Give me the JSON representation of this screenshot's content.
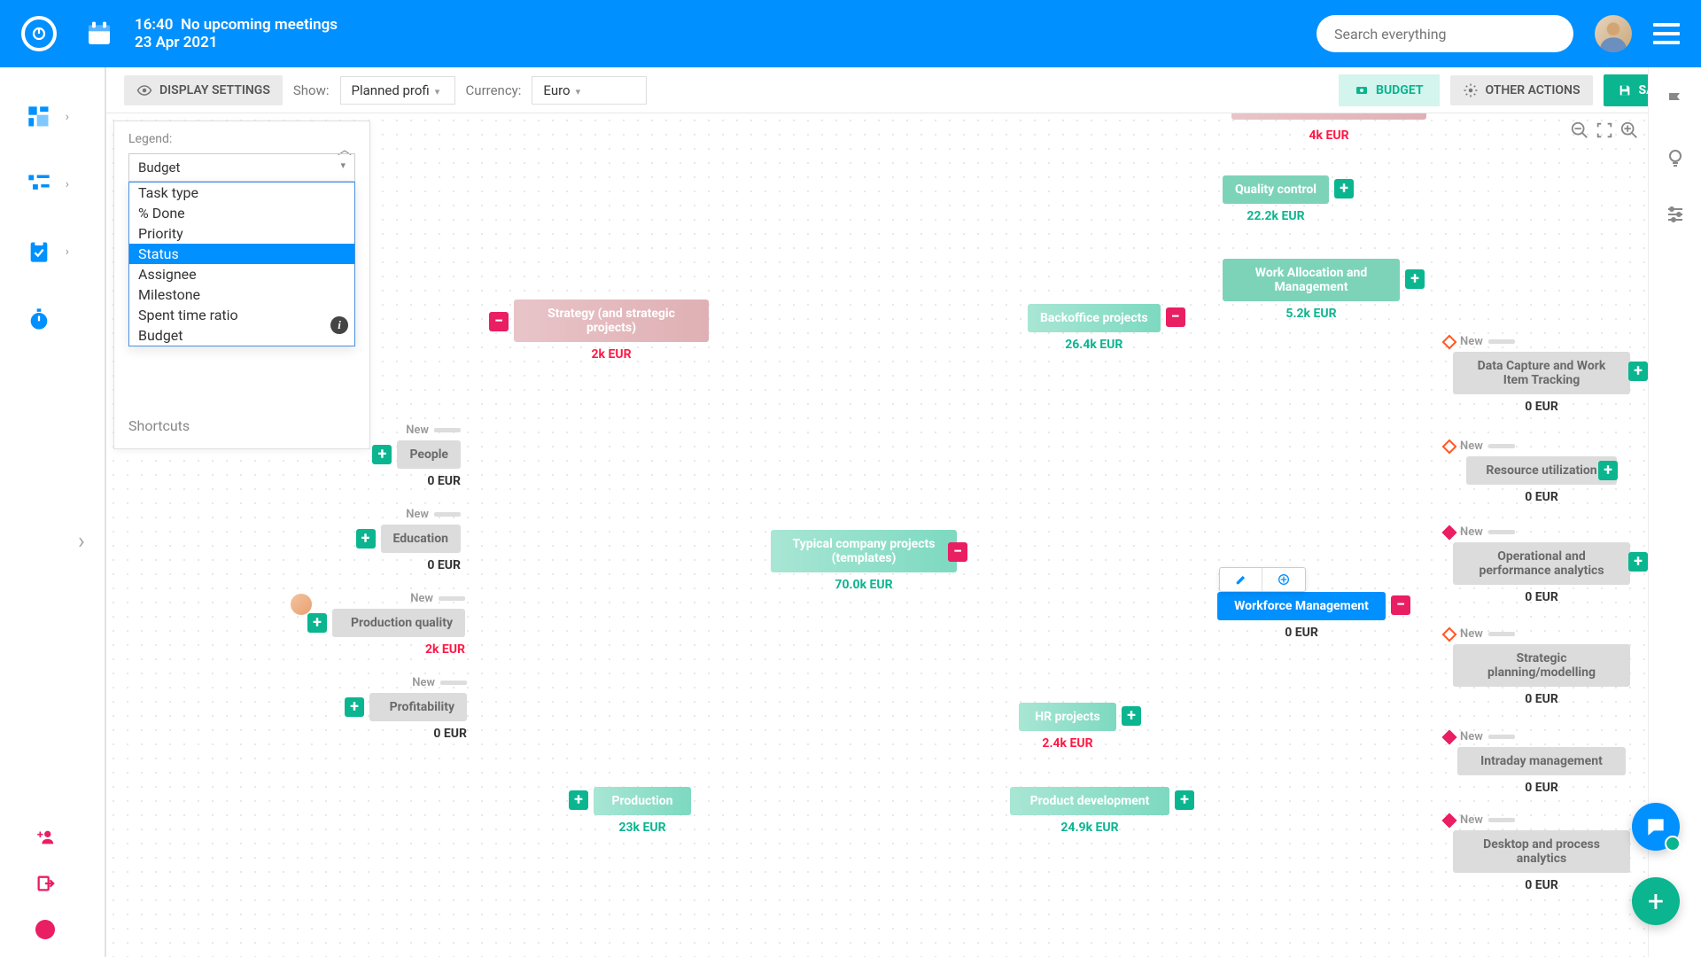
{
  "topbar": {
    "time": "16:40",
    "meetings": "No upcoming meetings",
    "date": "23 Apr 2021",
    "search_placeholder": "Search everything"
  },
  "toolbar": {
    "display_settings": "DISPLAY SETTINGS",
    "show_label": "Show:",
    "show_value": "Planned profi",
    "currency_label": "Currency:",
    "currency_value": "Euro",
    "budget": "BUDGET",
    "other_actions": "OTHER ACTIONS",
    "save": "SAVE"
  },
  "legend": {
    "title": "Legend:",
    "selected": "Budget",
    "options": [
      "Task type",
      "% Done",
      "Priority",
      "Status",
      "Assignee",
      "Milestone",
      "Spent time ratio",
      "Budget"
    ],
    "highlighted": "Status",
    "shortcuts": "Shortcuts"
  },
  "nodes": {
    "center": {
      "label": "Typical company projects (templates)",
      "value": "70.0k EUR"
    },
    "strategy": {
      "label": "Strategy (and strategic projects)",
      "value": "2k EUR"
    },
    "backoffice": {
      "label": "Backoffice projects",
      "value": "26.4k EUR"
    },
    "hr": {
      "label": "HR projects",
      "value": "2.4k EUR"
    },
    "prod_dev": {
      "label": "Product development",
      "value": "24.9k EUR"
    },
    "production": {
      "label": "Production",
      "value": "23k EUR"
    },
    "top_value": "4k EUR",
    "quality": {
      "label": "Quality control",
      "value": "22.2k EUR"
    },
    "work_alloc": {
      "label": "Work Allocation and Management",
      "value": "5.2k EUR"
    },
    "workforce": {
      "label": "Workforce Management",
      "value": "0 EUR"
    },
    "people": {
      "label": "People",
      "value": "0 EUR",
      "status": "New"
    },
    "education": {
      "label": "Education",
      "value": "0 EUR",
      "status": "New"
    },
    "prod_quality": {
      "label": "Production quality",
      "value": "2k EUR",
      "status": "New"
    },
    "profitability": {
      "label": "Profitability",
      "value": "0 EUR",
      "status": "New"
    },
    "data_capture": {
      "label": "Data Capture and Work Item Tracking",
      "value": "0 EUR",
      "status": "New"
    },
    "resource_util": {
      "label": "Resource utilization",
      "value": "0 EUR",
      "status": "New"
    },
    "operational": {
      "label": "Operational and performance analytics",
      "value": "0 EUR",
      "status": "New"
    },
    "strategic_plan": {
      "label": "Strategic planning/modelling",
      "value": "0 EUR",
      "status": "New"
    },
    "intraday": {
      "label": "Intraday management",
      "value": "0 EUR",
      "status": "New"
    },
    "desktop": {
      "label": "Desktop and process analytics",
      "value": "0 EUR",
      "status": "New"
    }
  }
}
